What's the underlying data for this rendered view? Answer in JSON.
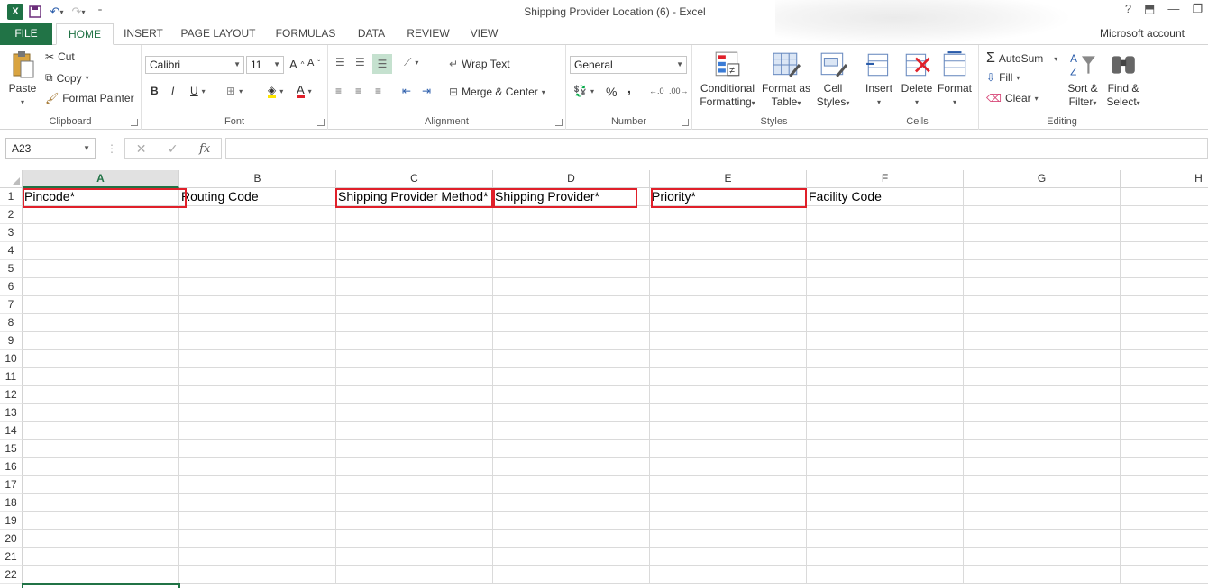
{
  "window": {
    "title": "Shipping Provider Location (6) - Excel",
    "account": "Microsoft account"
  },
  "tabs": [
    "FILE",
    "HOME",
    "INSERT",
    "PAGE LAYOUT",
    "FORMULAS",
    "DATA",
    "REVIEW",
    "VIEW"
  ],
  "ribbon": {
    "clipboard": {
      "label": "Clipboard",
      "paste": "Paste",
      "cut": "Cut",
      "copy": "Copy",
      "format_painter": "Format Painter"
    },
    "font": {
      "label": "Font",
      "family": "Calibri",
      "size": "11",
      "bold": "B",
      "italic": "I",
      "underline": "U"
    },
    "alignment": {
      "label": "Alignment",
      "wrap_text": "Wrap Text",
      "merge_center": "Merge & Center"
    },
    "number": {
      "label": "Number",
      "format": "General",
      "percent": "%",
      "comma": ","
    },
    "styles": {
      "label": "Styles",
      "conditional_1": "Conditional",
      "conditional_2": "Formatting",
      "format_table_1": "Format as",
      "format_table_2": "Table",
      "cell_styles_1": "Cell",
      "cell_styles_2": "Styles"
    },
    "cells": {
      "label": "Cells",
      "insert": "Insert",
      "delete": "Delete",
      "format": "Format"
    },
    "editing": {
      "label": "Editing",
      "autosum": "AutoSum",
      "fill": "Fill",
      "clear": "Clear",
      "sort_1": "Sort &",
      "sort_2": "Filter",
      "find_1": "Find &",
      "find_2": "Select"
    }
  },
  "formula_bar": {
    "name_box": "A23",
    "fx": "fx",
    "value": ""
  },
  "columns": [
    "A",
    "B",
    "C",
    "D",
    "E",
    "F",
    "G",
    "H"
  ],
  "rows": [
    "1",
    "2",
    "3",
    "4",
    "5",
    "6",
    "7",
    "8",
    "9",
    "10",
    "11",
    "12",
    "13",
    "14",
    "15",
    "16",
    "17",
    "18",
    "19",
    "20",
    "21",
    "22"
  ],
  "row1": {
    "A": "Pincode*",
    "B": "Routing Code",
    "C": "Shipping Provider Method*",
    "D": "Shipping Provider*",
    "E": "Priority*",
    "F": "Facility Code"
  },
  "colors": {
    "excel_green": "#217346",
    "highlight_red": "#e0202a"
  }
}
